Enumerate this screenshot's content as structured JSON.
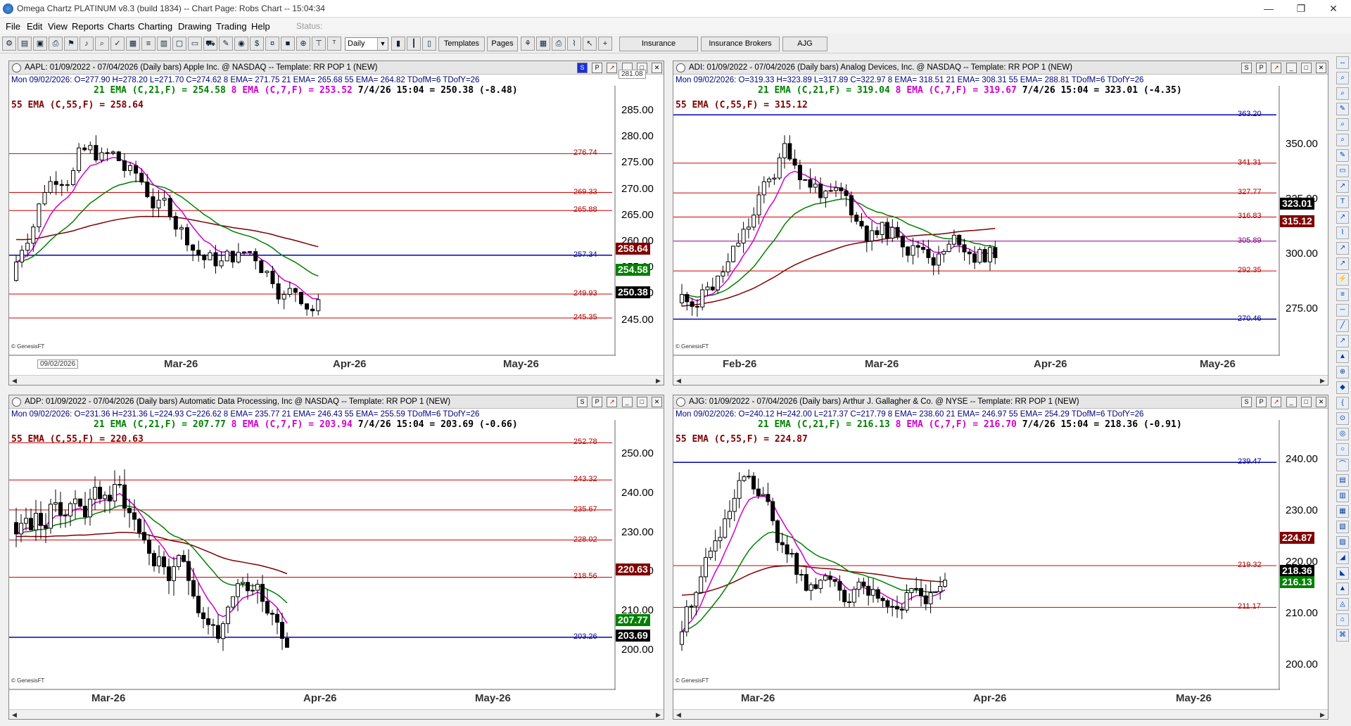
{
  "window": {
    "title": "Omega Chartz PLATINUM v8.3 (build 1834)  --  Chart Page: Robs Chart -- 15:04:34"
  },
  "menu": {
    "items": [
      "File",
      "Edit",
      "View",
      "Reports",
      "Charts",
      "Charting",
      "Drawing",
      "Trading",
      "Help"
    ],
    "status_label": "Status:"
  },
  "toolbar": {
    "interval": "Daily",
    "templates_label": "Templates",
    "pages_label": "Pages",
    "tabs": [
      "Insurance",
      "Insurance Brokers",
      "AJG"
    ]
  },
  "panels": [
    {
      "header": "AAPL: 01/09/2022 - 07/04/2026  (Daily bars)  Apple Inc. @ NASDAQ  --  Template: RR POP 1 (NEW)",
      "stats": "Mon   09/02/2026:  O=277.90  H=278.20  L=271.70  C=274.62  8 EMA= 271.75  21 EMA= 265.68  55 EMA= 264.82  TDofM=6  TDofY=26",
      "ema21": "21 EMA (C,21,F) = 254.58",
      "ema8": "8 EMA (C,7,F) = 253.52",
      "last": "7/4/26 15:04 = 250.38 (-8.48)",
      "ema55": "55 EMA (C,55,F) = 258.64",
      "xlabels": [
        "Mar-26",
        "Apr-26",
        "May-26"
      ],
      "ylabels": [
        "285.00",
        "280.00",
        "275.00",
        "270.00",
        "265.00",
        "260.00",
        "255.00",
        "250.00",
        "245.00"
      ],
      "levels": [
        {
          "label": "276.74",
          "color": "red"
        },
        {
          "label": "269.33",
          "color": "red"
        },
        {
          "label": "265.88",
          "color": "red"
        },
        {
          "label": "257.34",
          "color": "blue"
        },
        {
          "label": "249.93",
          "color": "red"
        },
        {
          "label": "245.35",
          "color": "red"
        }
      ],
      "tags": [
        {
          "label": "258.64",
          "color": "#800000"
        },
        {
          "label": "254.58",
          "color": "#008000"
        },
        {
          "label": "250.38",
          "color": "#000000"
        }
      ],
      "top_tag": "281.08",
      "date_box": "09/02/2026",
      "buttons": [
        "S",
        "P",
        "↗"
      ]
    },
    {
      "header": "ADI: 01/09/2022 - 07/04/2026  (Daily bars)  Analog Devices, Inc. @ NASDAQ  --  Template: RR POP 1 (NEW)",
      "stats": "Mon   09/02/2026:  O=319.33  H=323.89  L=317.89  C=322.97  8 EMA= 318.51  21 EMA= 308.31  55 EMA= 288.81  TDofM=6  TDofY=26",
      "ema21": "21 EMA (C,21,F) = 319.04",
      "ema8": "8 EMA (C,7,F) = 319.67",
      "last": "7/4/26 15:04 = 323.01 (-4.35)",
      "ema55": "55 EMA (C,55,F) = 315.12",
      "xlabels": [
        "Feb-26",
        "Mar-26",
        "Apr-26",
        "May-26"
      ],
      "ylabels": [
        "350.00",
        "325.00",
        "300.00",
        "275.00"
      ],
      "levels": [
        {
          "label": "363.20",
          "color": "blue"
        },
        {
          "label": "341.31",
          "color": "red"
        },
        {
          "label": "327.77",
          "color": "red"
        },
        {
          "label": "316.83",
          "color": "red"
        },
        {
          "label": "305.89",
          "color": "purple"
        },
        {
          "label": "292.35",
          "color": "red"
        },
        {
          "label": "270.46",
          "color": "blue"
        }
      ],
      "tags": [
        {
          "label": "323.01",
          "color": "#000000"
        },
        {
          "label": "315.12",
          "color": "#800000"
        }
      ],
      "buttons": [
        "S",
        "P",
        "↗"
      ]
    },
    {
      "header": "ADP: 01/09/2022 - 07/04/2026  (Daily bars)  Automatic Data Processing, Inc @ NASDAQ  --  Template: RR POP 1 (NEW)",
      "stats": "Mon   09/02/2026:  O=231.36  H=231.36  L=224.93  C=226.62  8 EMA= 235.77  21 EMA= 246.43  55 EMA= 255.59  TDofM=6  TDofY=26",
      "ema21": "21 EMA (C,21,F) = 207.77",
      "ema8": "8 EMA (C,7,F) = 203.94",
      "last": "7/4/26 15:04 = 203.69 (-0.66)",
      "ema55": "55 EMA (C,55,F) = 220.63",
      "xlabels": [
        "Mar-26",
        "Apr-26",
        "May-26"
      ],
      "ylabels": [
        "250.00",
        "240.00",
        "230.00",
        "220.00",
        "210.00",
        "200.00"
      ],
      "levels": [
        {
          "label": "252.78",
          "color": "red"
        },
        {
          "label": "243.32",
          "color": "red"
        },
        {
          "label": "235.67",
          "color": "red"
        },
        {
          "label": "228.02",
          "color": "red"
        },
        {
          "label": "218.56",
          "color": "red"
        },
        {
          "label": "203.26",
          "color": "blue"
        }
      ],
      "tags": [
        {
          "label": "220.63",
          "color": "#800000"
        },
        {
          "label": "207.77",
          "color": "#008000"
        },
        {
          "label": "203.69",
          "color": "#000000"
        }
      ],
      "buttons": [
        "S",
        "P",
        "↗"
      ]
    },
    {
      "header": "AJG: 01/09/2022 - 07/04/2026  (Daily bars)  Arthur J. Gallagher & Co. @ NYSE  --  Template: RR POP 1 (NEW)",
      "stats": "Mon   09/02/2026:  O=240.12  H=242.00  L=217.37  C=217.79  8 EMA= 238.60  21 EMA= 246.97  55 EMA= 254.29  TDofM=6  TDofY=26",
      "ema21": "21 EMA (C,21,F) = 216.13",
      "ema8": "8 EMA (C,7,F) = 216.70",
      "last": "7/4/26 15:04 = 218.36 (-0.91)",
      "ema55": "55 EMA (C,55,F) = 224.87",
      "xlabels": [
        "Mar-26",
        "Apr-26",
        "May-26"
      ],
      "ylabels": [
        "240.00",
        "230.00",
        "220.00",
        "210.00",
        "200.00"
      ],
      "levels": [
        {
          "label": "239.47",
          "color": "blue"
        },
        {
          "label": "219.32",
          "color": "red"
        },
        {
          "label": "211.17",
          "color": "red"
        }
      ],
      "tags": [
        {
          "label": "224.87",
          "color": "#800000"
        },
        {
          "label": "218.36",
          "color": "#000000"
        },
        {
          "label": "216.13",
          "color": "#008000"
        }
      ],
      "buttons": [
        "S",
        "P",
        "↗"
      ]
    }
  ],
  "genesis": "© GenesisFT"
}
